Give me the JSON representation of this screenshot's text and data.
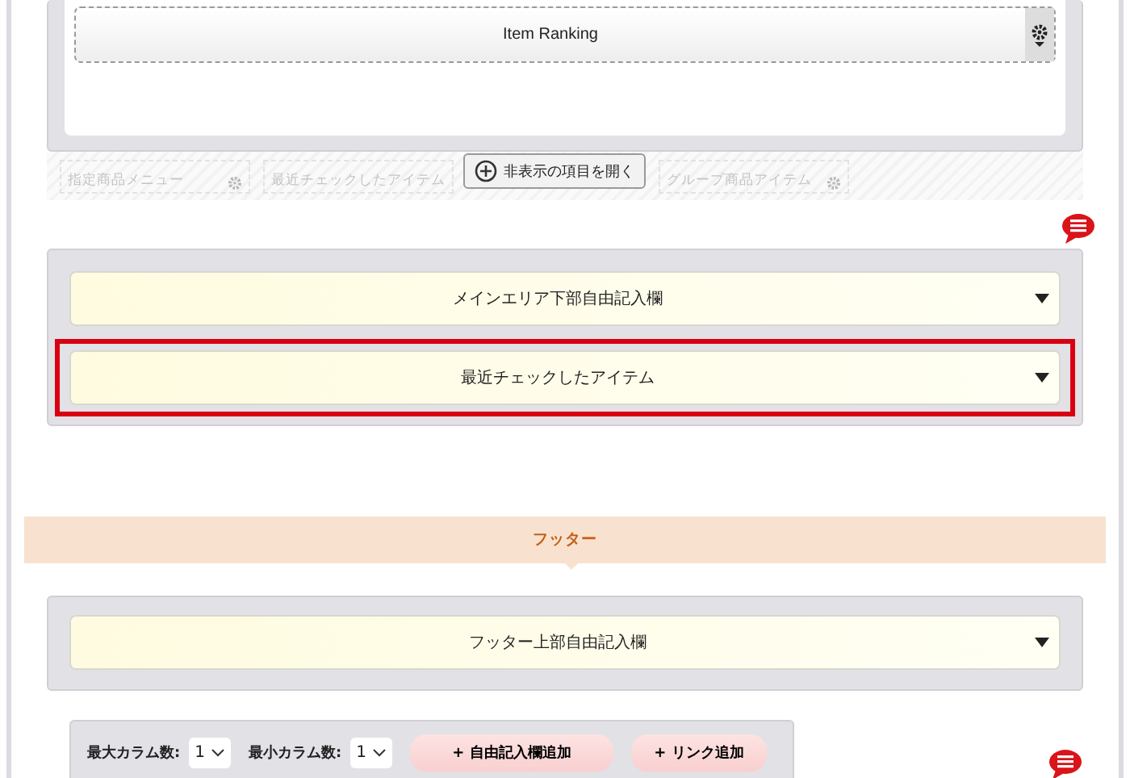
{
  "top_panel": {
    "item": {
      "label": "Item Ranking"
    }
  },
  "hidden_items": {
    "button": "非表示の項目を開く",
    "items": [
      {
        "label": "指定商品メニュー"
      },
      {
        "label": "最近チェックしたアイテム"
      },
      {
        "label": "グループ商品アイテム"
      }
    ]
  },
  "main_panel": {
    "items": [
      {
        "label": "メインエリア下部自由記入欄",
        "highlighted": false
      },
      {
        "label": "最近チェックしたアイテム",
        "highlighted": true
      }
    ]
  },
  "footer_banner": {
    "title": "フッター"
  },
  "footer_panel": {
    "items": [
      {
        "label": "フッター上部自由記入欄",
        "highlighted": false
      }
    ]
  },
  "toolbar": {
    "max_columns": {
      "label": "最大カラム数:",
      "value": "1"
    },
    "min_columns": {
      "label": "最小カラム数:",
      "value": "1"
    },
    "buttons": [
      "+ 自由記入欄追加",
      "+ リンク追加"
    ]
  }
}
